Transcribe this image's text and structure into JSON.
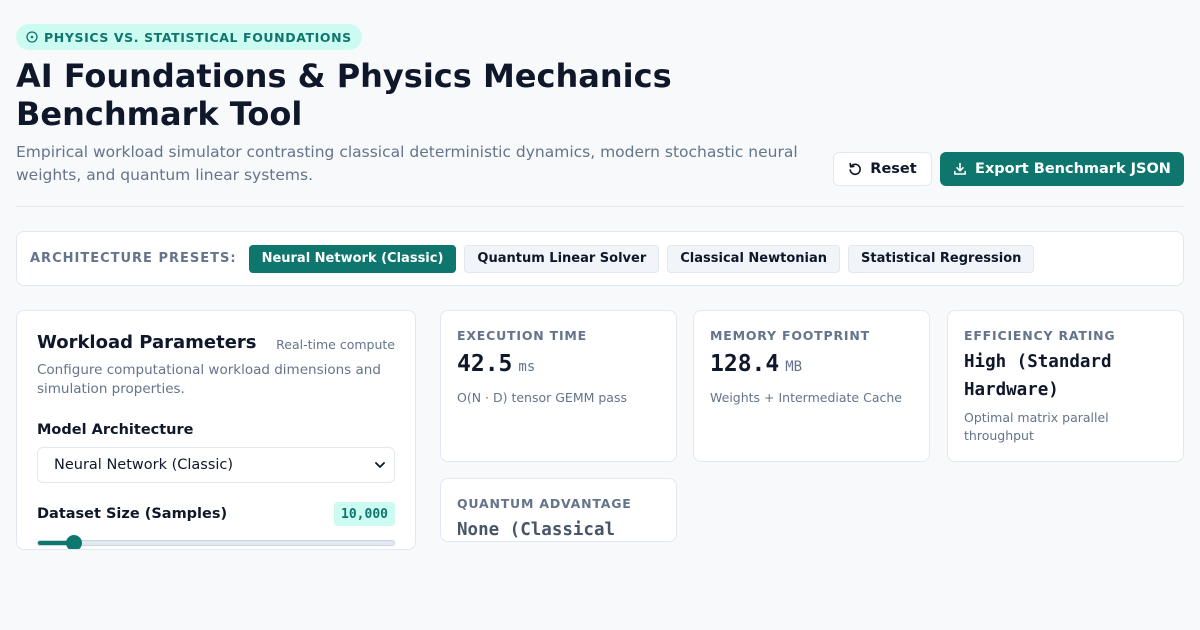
{
  "header": {
    "badge": "PHYSICS VS. STATISTICAL FOUNDATIONS",
    "title": "AI Foundations & Physics Mechanics Benchmark Tool",
    "subtitle": "Empirical workload simulator contrasting classical deterministic dynamics, modern stochastic neural weights, and quantum linear systems.",
    "reset_label": "Reset",
    "export_label": "Export Benchmark JSON"
  },
  "presets": {
    "label": "ARCHITECTURE PRESETS:",
    "items": [
      {
        "label": "Neural Network (Classic)",
        "active": true
      },
      {
        "label": "Quantum Linear Solver",
        "active": false
      },
      {
        "label": "Classical Newtonian",
        "active": false
      },
      {
        "label": "Statistical Regression",
        "active": false
      }
    ]
  },
  "params": {
    "title": "Workload Parameters",
    "tag": "Real-time compute",
    "description": "Configure computational workload dimensions and simulation properties.",
    "model_label": "Model Architecture",
    "model_value": "Neural Network (Classic)",
    "dataset_label": "Dataset Size (Samples)",
    "dataset_value": "10,000",
    "dataset_slider_fraction": 0.1
  },
  "metrics": {
    "execution": {
      "label": "EXECUTION TIME",
      "value": "42.5",
      "unit": "ms",
      "note": "O(N · D) tensor GEMM pass"
    },
    "memory": {
      "label": "MEMORY FOOTPRINT",
      "value": "128.4",
      "unit": "MB",
      "note": "Weights + Intermediate Cache"
    },
    "efficiency": {
      "label": "EFFICIENCY RATING",
      "value": "High (Standard Hardware)",
      "note": "Optimal matrix parallel throughput"
    },
    "quantum": {
      "label": "QUANTUM ADVANTAGE",
      "value": "None (Classical"
    }
  },
  "colors": {
    "accent": "#0f766e",
    "accent_light": "#ccfbf1"
  }
}
